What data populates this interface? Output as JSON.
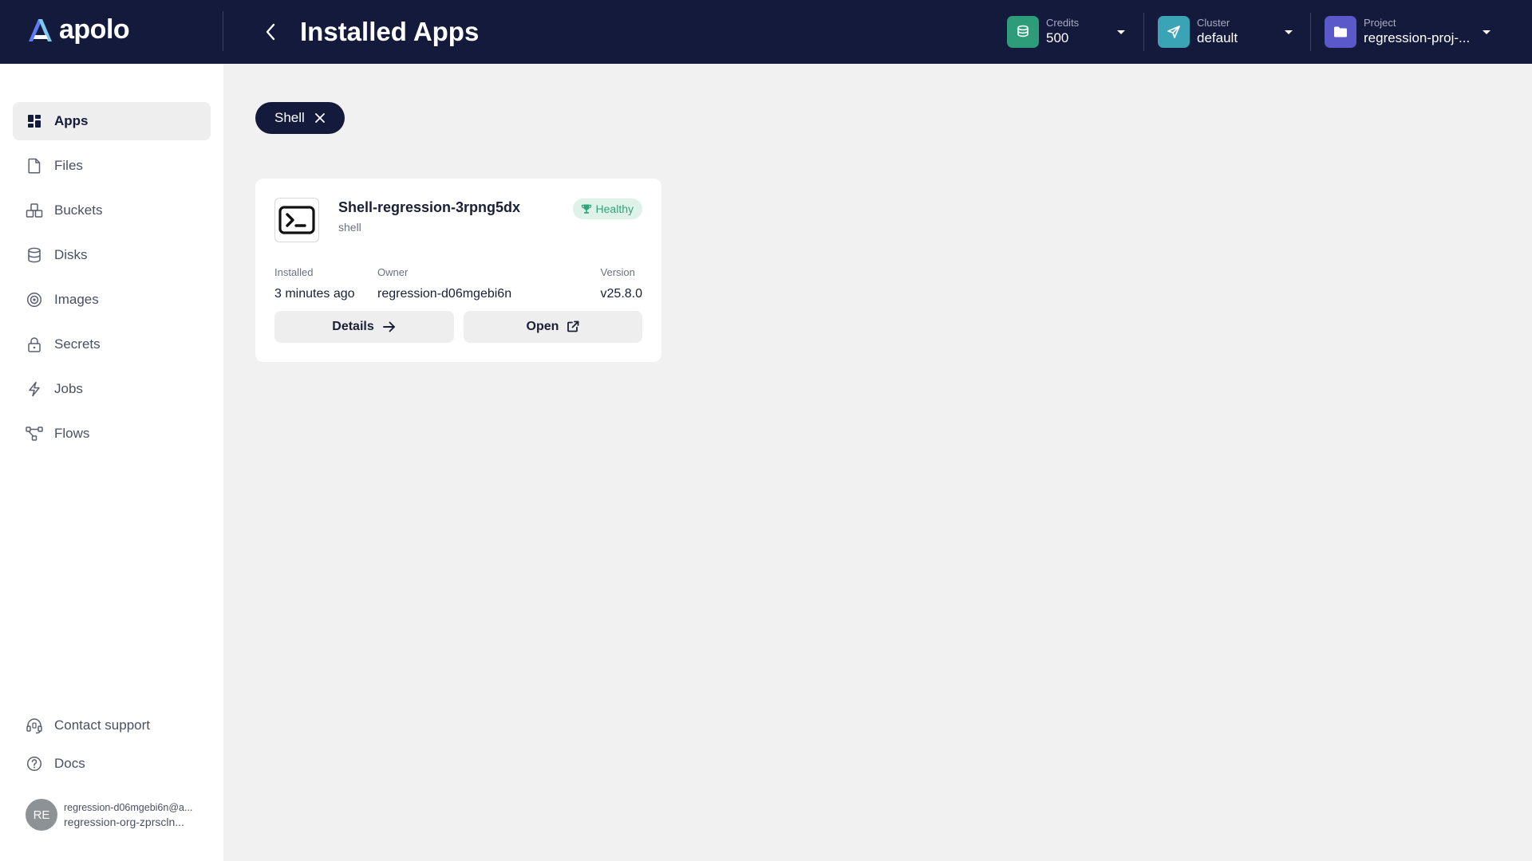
{
  "brand": {
    "name": "apolo"
  },
  "header": {
    "title": "Installed Apps",
    "credits": {
      "label": "Credits",
      "value": "500",
      "icon": "coins-icon",
      "color": "#2e9c78"
    },
    "cluster": {
      "label": "Cluster",
      "value": "default",
      "icon": "send-icon",
      "color": "#3ba3b6"
    },
    "project": {
      "label": "Project",
      "value": "regression-proj-...",
      "icon": "folder-icon",
      "color": "#5b58c9"
    }
  },
  "sidebar": {
    "items": [
      {
        "label": "Apps",
        "icon": "apps-grid-icon",
        "active": true
      },
      {
        "label": "Files",
        "icon": "file-icon"
      },
      {
        "label": "Buckets",
        "icon": "bucket-icon"
      },
      {
        "label": "Disks",
        "icon": "database-icon"
      },
      {
        "label": "Images",
        "icon": "disc-icon"
      },
      {
        "label": "Secrets",
        "icon": "lock-icon"
      },
      {
        "label": "Jobs",
        "icon": "lightning-icon"
      },
      {
        "label": "Flows",
        "icon": "flow-icon"
      }
    ],
    "footer": [
      {
        "label": "Contact support",
        "icon": "headset-icon"
      },
      {
        "label": "Docs",
        "icon": "help-circle-icon"
      }
    ],
    "user": {
      "initials": "RE",
      "email": "regression-d06mgebi6n@a...",
      "org": "regression-org-zprscln..."
    }
  },
  "filter": {
    "chip_label": "Shell"
  },
  "app_card": {
    "name": "Shell-regression-3rpng5dx",
    "type": "shell",
    "status": "Healthy",
    "status_color": "#2ea57a",
    "installed_label": "Installed",
    "installed_value": "3 minutes ago",
    "owner_label": "Owner",
    "owner_value": "regression-d06mgebi6n",
    "version_label": "Version",
    "version_value": "v25.8.0",
    "details_label": "Details",
    "open_label": "Open"
  }
}
